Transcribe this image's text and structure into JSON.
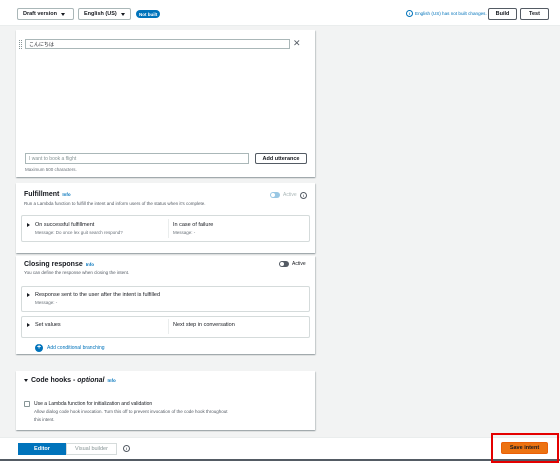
{
  "topbar": {
    "version_dropdown": "Draft version",
    "language_dropdown": "English (US)",
    "status_badge": "Not built",
    "notice": "English (US) has not built changes.",
    "build_button": "Build",
    "test_button": "Test"
  },
  "utterances": {
    "sample_value": "こんにちは",
    "new_placeholder": "I want to book a flight",
    "add_button": "Add utterance",
    "max_hint": "Maximum 500 characters."
  },
  "fulfillment": {
    "title": "Fulfillment",
    "info": "Info",
    "description": "Run a Lambda function to fulfill the intent and inform users of the status when it's complete.",
    "active_label": "Active",
    "success_title": "On successful fulfillment",
    "success_sub": "Message: Do once lex guit search respond?",
    "failure_title": "In case of failure",
    "failure_sub": "Message: -"
  },
  "closing": {
    "title": "Closing response",
    "info": "Info",
    "description": "You can define the response when closing the intent.",
    "active_label": "Active",
    "response_title": "Response sent to the user after the intent is fulfilled",
    "response_sub": "Message: -",
    "set_values": "Set values",
    "next_step": "Next step in conversation",
    "add_branching": "Add conditional branching"
  },
  "code_hooks": {
    "title": "Code hooks - ",
    "optional": "optional",
    "info": "Info",
    "checkbox_label": "Use a Lambda function for initialization and validation",
    "checkbox_desc_1": "Allow dialog code hook invocation. Turn this off to prevent invocation of the code hook throughout",
    "checkbox_desc_2": "this intent."
  },
  "bottombar": {
    "editor_tab": "Editor",
    "visual_builder_tab": "Visual builder",
    "save_button": "Save intent"
  },
  "colors": {
    "accent": "#0073bb",
    "save": "#ec7211",
    "highlight": "#e40000"
  }
}
